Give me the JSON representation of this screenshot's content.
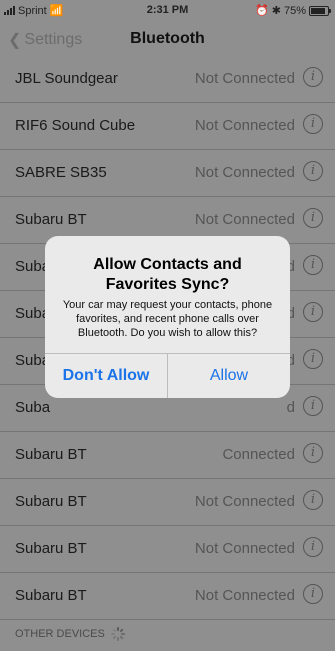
{
  "status_bar": {
    "carrier": "Sprint",
    "time": "2:31 PM",
    "battery": "75%"
  },
  "nav": {
    "back_label": "Settings",
    "title": "Bluetooth"
  },
  "devices": [
    {
      "name": "JBL Soundgear",
      "status": "Not Connected"
    },
    {
      "name": "RIF6 Sound Cube",
      "status": "Not Connected"
    },
    {
      "name": "SABRE SB35",
      "status": "Not Connected"
    },
    {
      "name": "Subaru BT",
      "status": "Not Connected"
    },
    {
      "name": "Suba",
      "status": "d"
    },
    {
      "name": "Suba",
      "status": "d"
    },
    {
      "name": "Suba",
      "status": "d"
    },
    {
      "name": "Suba",
      "status": "d"
    },
    {
      "name": "Subaru BT",
      "status": "Connected"
    },
    {
      "name": "Subaru BT",
      "status": "Not Connected"
    },
    {
      "name": "Subaru BT",
      "status": "Not Connected"
    },
    {
      "name": "Subaru BT",
      "status": "Not Connected"
    }
  ],
  "other_devices_header": "OTHER DEVICES",
  "alert": {
    "title": "Allow Contacts and Favorites Sync?",
    "message": "Your car may request your contacts, phone favorites, and recent phone calls over Bluetooth. Do you wish to allow this?",
    "cancel_label": "Don't Allow",
    "allow_label": "Allow"
  },
  "colors": {
    "accent": "#1a73e8",
    "dim_background": "#8f8f8f"
  }
}
